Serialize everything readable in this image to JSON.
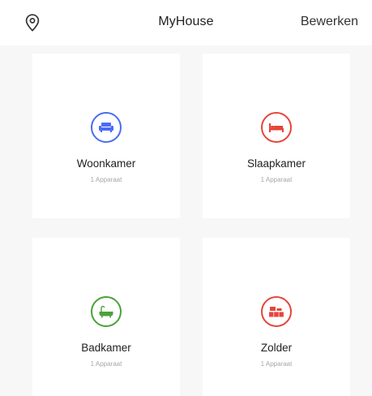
{
  "header": {
    "title": "MyHouse",
    "edit_label": "Bewerken",
    "location_icon": "location-pin-icon"
  },
  "rooms": [
    {
      "name": "Woonkamer",
      "count": "1 Apparaat",
      "icon": "sofa-icon",
      "color": "#4a6cf7"
    },
    {
      "name": "Slaapkamer",
      "count": "1 Apparaat",
      "icon": "bed-icon",
      "color": "#e6453a"
    },
    {
      "name": "Badkamer",
      "count": "1 Apparaat",
      "icon": "bathtub-icon",
      "color": "#4aa23a"
    },
    {
      "name": "Zolder",
      "count": "1 Apparaat",
      "icon": "boxes-icon",
      "color": "#e6453a"
    }
  ]
}
